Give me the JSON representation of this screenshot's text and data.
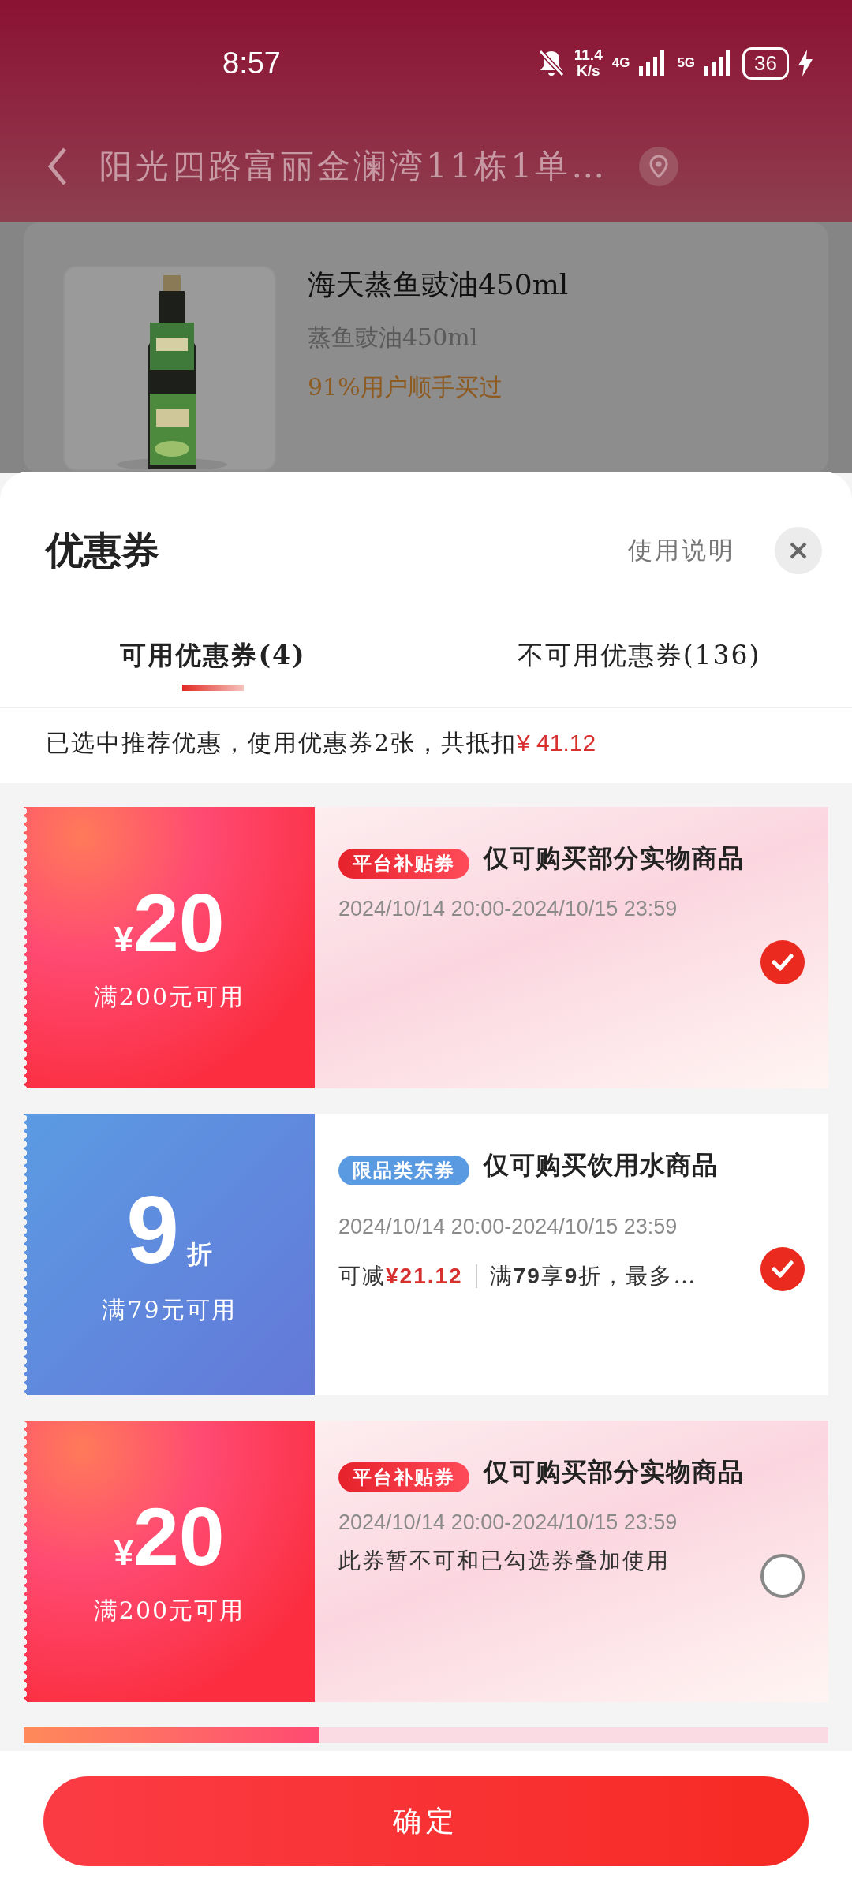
{
  "status_bar": {
    "time": "8:57",
    "speed_value": "11.4",
    "speed_unit": "K/s",
    "network_1": "4G",
    "network_2": "5G",
    "battery": "36"
  },
  "header": {
    "address": "阳光四路富丽金澜湾11栋1单…"
  },
  "product": {
    "name": "海天蒸鱼豉油450ml",
    "spec": "蒸鱼豉油450ml",
    "hint": "91%用户顺手买过"
  },
  "sheet": {
    "title": "优惠券",
    "help_link": "使用说明",
    "tabs": [
      {
        "label": "可用优惠券(4)",
        "selected": true
      },
      {
        "label": "不可用优惠券(136)",
        "selected": false
      }
    ],
    "summary": "已选中推荐优惠，使用优惠券2张，共抵扣",
    "summary_amount": "¥ 41.12",
    "coupons": [
      {
        "kind": "amount",
        "currency": "¥",
        "value": "20",
        "condition": "满200元可用",
        "tag": "平台补贴券",
        "title": "仅可购买部分实物商品",
        "validity": "2024/10/14 20:00-2024/10/15 23:59",
        "selected": true
      },
      {
        "kind": "discount",
        "value": "9",
        "unit": "折",
        "condition": "满79元可用",
        "tag": "限品类东券",
        "title": "仅可购买饮用水商品",
        "validity": "2024/10/14 20:00-2024/10/15 23:59",
        "notes": [
          "可减**¥21.12**",
          "满**79**享**9**折，最多…"
        ],
        "selected": true
      },
      {
        "kind": "amount",
        "currency": "¥",
        "value": "20",
        "condition": "满200元可用",
        "tag": "平台补贴券",
        "title": "仅可购买部分实物商品",
        "validity": "2024/10/14 20:00-2024/10/15 23:59",
        "notes": [
          "此券暂不可和已勾选券叠加使用"
        ],
        "selected": false
      }
    ],
    "confirm_button": "确定"
  }
}
